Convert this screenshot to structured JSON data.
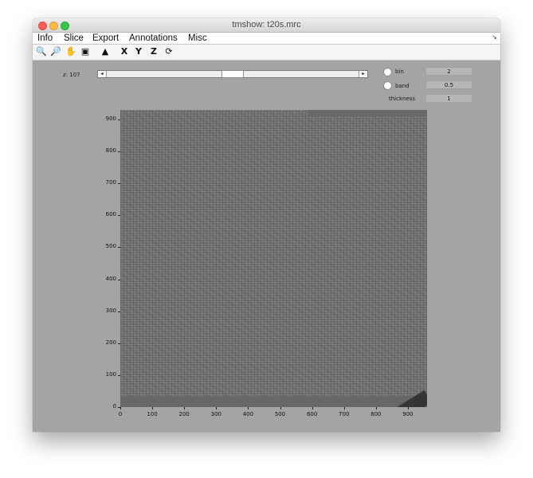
{
  "window": {
    "title": "tmshow: t20s.mrc"
  },
  "menu": {
    "items": [
      "Info",
      "Slice",
      "Export",
      "Annotations",
      "Misc"
    ],
    "collapse_glyph": "↘"
  },
  "toolbar": {
    "tools": [
      {
        "name": "zoom-in-icon",
        "glyph": "🔍"
      },
      {
        "name": "zoom-out-icon",
        "glyph": "🔎"
      },
      {
        "name": "pan-hand-icon",
        "glyph": "✋"
      },
      {
        "name": "contrast-image-icon",
        "glyph": "▣"
      },
      {
        "name": "histogram-icon",
        "glyph": "▲"
      },
      {
        "name": "x-view-button",
        "glyph": "X"
      },
      {
        "name": "y-view-button",
        "glyph": "Y"
      },
      {
        "name": "z-view-button",
        "glyph": "Z"
      },
      {
        "name": "rotate-3d-icon",
        "glyph": "⟳"
      }
    ]
  },
  "controls": {
    "z_label": "z: 107",
    "slider_value_fraction": 0.5,
    "bin_label": "bin",
    "bin_value": "2",
    "band_label": "band",
    "band_value": "0.5",
    "thickness_label": "thickness",
    "thickness_value": "1"
  },
  "plot": {
    "y_ticks": [
      "900",
      "800",
      "700",
      "600",
      "500",
      "400",
      "300",
      "200",
      "100",
      "0"
    ],
    "x_ticks": [
      "0",
      "100",
      "200",
      "300",
      "400",
      "500",
      "600",
      "700",
      "800",
      "900"
    ],
    "x_range": [
      0,
      960
    ],
    "y_range": [
      0,
      930
    ]
  }
}
